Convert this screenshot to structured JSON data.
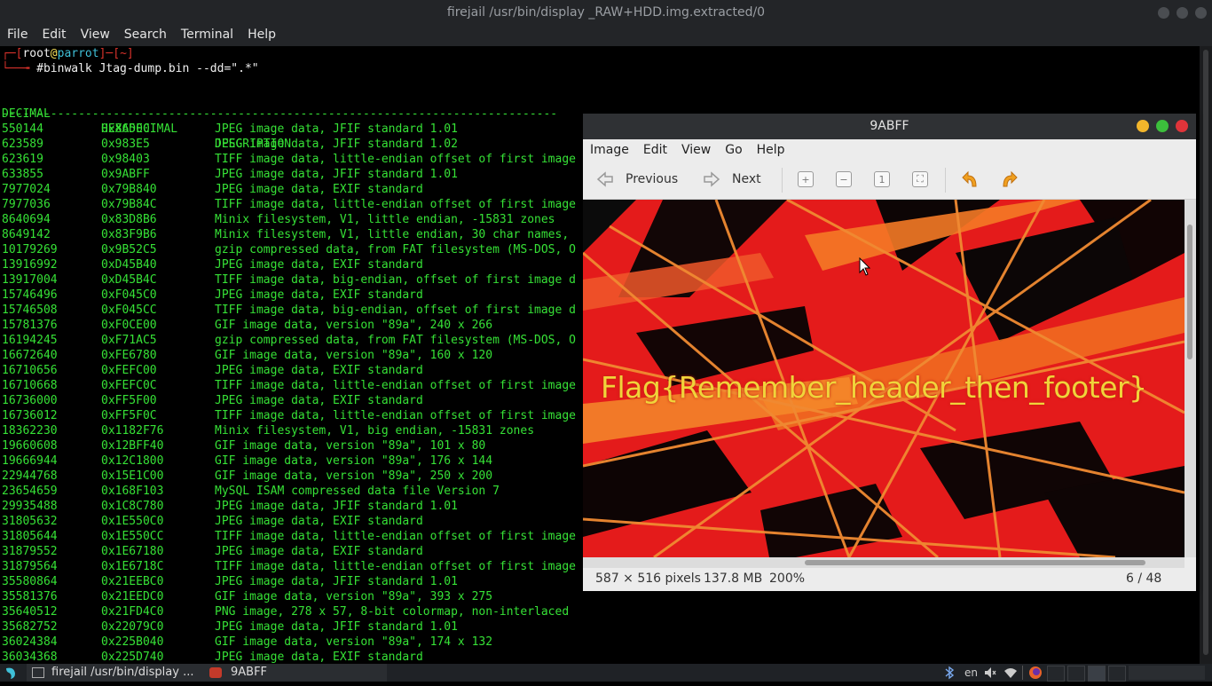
{
  "terminal": {
    "title": "firejail /usr/bin/display _RAW+HDD.img.extracted/0",
    "menu": [
      "File",
      "Edit",
      "View",
      "Search",
      "Terminal",
      "Help"
    ],
    "prompt_user": "root",
    "prompt_at": "@",
    "prompt_host": "parrot",
    "prompt_dir": "~",
    "command": "#binwalk Jtag-dump.bin --dd=\".*\"",
    "headers": {
      "decimal": "DECIMAL",
      "hex": "HEXADECIMAL",
      "desc": "DESCRIPTION"
    },
    "divider": "--------------------------------------------------------------------------------",
    "rows": [
      {
        "dec": "550144",
        "hex": "0x86500",
        "desc": "JPEG image data, JFIF standard 1.01"
      },
      {
        "dec": "623589",
        "hex": "0x983E5",
        "desc": "JPEG image data, JFIF standard 1.02"
      },
      {
        "dec": "623619",
        "hex": "0x98403",
        "desc": "TIFF image data, little-endian offset of first image"
      },
      {
        "dec": "633855",
        "hex": "0x9ABFF",
        "desc": "JPEG image data, JFIF standard 1.01"
      },
      {
        "dec": "7977024",
        "hex": "0x79B840",
        "desc": "JPEG image data, EXIF standard"
      },
      {
        "dec": "7977036",
        "hex": "0x79B84C",
        "desc": "TIFF image data, little-endian offset of first image"
      },
      {
        "dec": "8640694",
        "hex": "0x83D8B6",
        "desc": "Minix filesystem, V1, little endian, -15831 zones"
      },
      {
        "dec": "8649142",
        "hex": "0x83F9B6",
        "desc": "Minix filesystem, V1, little endian, 30 char names,"
      },
      {
        "dec": "10179269",
        "hex": "0x9B52C5",
        "desc": "gzip compressed data, from FAT filesystem (MS-DOS, O"
      },
      {
        "dec": "13916992",
        "hex": "0xD45B40",
        "desc": "JPEG image data, EXIF standard"
      },
      {
        "dec": "13917004",
        "hex": "0xD45B4C",
        "desc": "TIFF image data, big-endian, offset of first image d"
      },
      {
        "dec": "15746496",
        "hex": "0xF045C0",
        "desc": "JPEG image data, EXIF standard"
      },
      {
        "dec": "15746508",
        "hex": "0xF045CC",
        "desc": "TIFF image data, big-endian, offset of first image d"
      },
      {
        "dec": "15781376",
        "hex": "0xF0CE00",
        "desc": "GIF image data, version \"89a\", 240 x 266"
      },
      {
        "dec": "16194245",
        "hex": "0xF71AC5",
        "desc": "gzip compressed data, from FAT filesystem (MS-DOS, O"
      },
      {
        "dec": "16672640",
        "hex": "0xFE6780",
        "desc": "GIF image data, version \"89a\", 160 x 120"
      },
      {
        "dec": "16710656",
        "hex": "0xFEFC00",
        "desc": "JPEG image data, EXIF standard"
      },
      {
        "dec": "16710668",
        "hex": "0xFEFC0C",
        "desc": "TIFF image data, little-endian offset of first image"
      },
      {
        "dec": "16736000",
        "hex": "0xFF5F00",
        "desc": "JPEG image data, EXIF standard"
      },
      {
        "dec": "16736012",
        "hex": "0xFF5F0C",
        "desc": "TIFF image data, little-endian offset of first image"
      },
      {
        "dec": "18362230",
        "hex": "0x1182F76",
        "desc": "Minix filesystem, V1, big endian, -15831 zones"
      },
      {
        "dec": "19660608",
        "hex": "0x12BFF40",
        "desc": "GIF image data, version \"89a\", 101 x 80"
      },
      {
        "dec": "19666944",
        "hex": "0x12C1800",
        "desc": "GIF image data, version \"89a\", 176 x 144"
      },
      {
        "dec": "22944768",
        "hex": "0x15E1C00",
        "desc": "GIF image data, version \"89a\", 250 x 200"
      },
      {
        "dec": "23654659",
        "hex": "0x168F103",
        "desc": "MySQL ISAM compressed data file Version 7"
      },
      {
        "dec": "29935488",
        "hex": "0x1C8C780",
        "desc": "JPEG image data, JFIF standard 1.01"
      },
      {
        "dec": "31805632",
        "hex": "0x1E550C0",
        "desc": "JPEG image data, EXIF standard"
      },
      {
        "dec": "31805644",
        "hex": "0x1E550CC",
        "desc": "TIFF image data, little-endian offset of first image"
      },
      {
        "dec": "31879552",
        "hex": "0x1E67180",
        "desc": "JPEG image data, EXIF standard"
      },
      {
        "dec": "31879564",
        "hex": "0x1E6718C",
        "desc": "TIFF image data, little-endian offset of first image"
      },
      {
        "dec": "35580864",
        "hex": "0x21EEBC0",
        "desc": "JPEG image data, JFIF standard 1.01"
      },
      {
        "dec": "35581376",
        "hex": "0x21EEDC0",
        "desc": "GIF image data, version \"89a\", 393 x 275"
      },
      {
        "dec": "35640512",
        "hex": "0x21FD4C0",
        "desc": "PNG image, 278 x 57, 8-bit colormap, non-interlaced"
      },
      {
        "dec": "35682752",
        "hex": "0x22079C0",
        "desc": "JPEG image data, JFIF standard 1.01"
      },
      {
        "dec": "36024384",
        "hex": "0x225B040",
        "desc": "GIF image data, version \"89a\", 174 x 132"
      },
      {
        "dec": "36034368",
        "hex": "0x225D740",
        "desc": "JPEG image data, EXIF standard"
      }
    ]
  },
  "viewer": {
    "title": "9ABFF",
    "menu": [
      "Image",
      "Edit",
      "View",
      "Go",
      "Help"
    ],
    "previous_label": "Previous",
    "next_label": "Next",
    "flag_text": "Flag{Remember_header_then_footer}",
    "status_size": "587 × 516 pixels",
    "status_memory": "137.8 MB",
    "status_zoom": "200%",
    "status_position": "6 / 48"
  },
  "taskbar": {
    "terminal_task": "firejail /usr/bin/display ...",
    "viewer_task": "9ABFF",
    "lang": "en"
  },
  "colors": {
    "terminal_green": "#36e136",
    "viewer_close": "#e0343a",
    "viewer_max": "#3cbf3c",
    "viewer_min": "#f2b52b"
  }
}
